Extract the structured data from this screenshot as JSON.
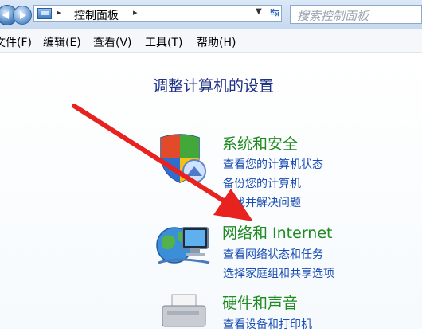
{
  "address_bar": {
    "breadcrumb": "控制面板",
    "search_placeholder": "搜索控制面板"
  },
  "menu": [
    "文件(F)",
    "编辑(E)",
    "查看(V)",
    "工具(T)",
    "帮助(H)"
  ],
  "page": {
    "heading": "调整计算机的设置"
  },
  "categories": [
    {
      "title": "系统和安全",
      "icon": "shield-icon",
      "links": [
        "查看您的计算机状态",
        "备份您的计算机",
        "查找并解决问题"
      ]
    },
    {
      "title": "网络和 Internet",
      "icon": "network-icon",
      "links": [
        "查看网络状态和任务",
        "选择家庭组和共享选项"
      ]
    },
    {
      "title": "硬件和声音",
      "icon": "printer-icon",
      "links": [
        "查看设备和打印机"
      ]
    }
  ],
  "annotation": {
    "color": "#e8221e"
  }
}
